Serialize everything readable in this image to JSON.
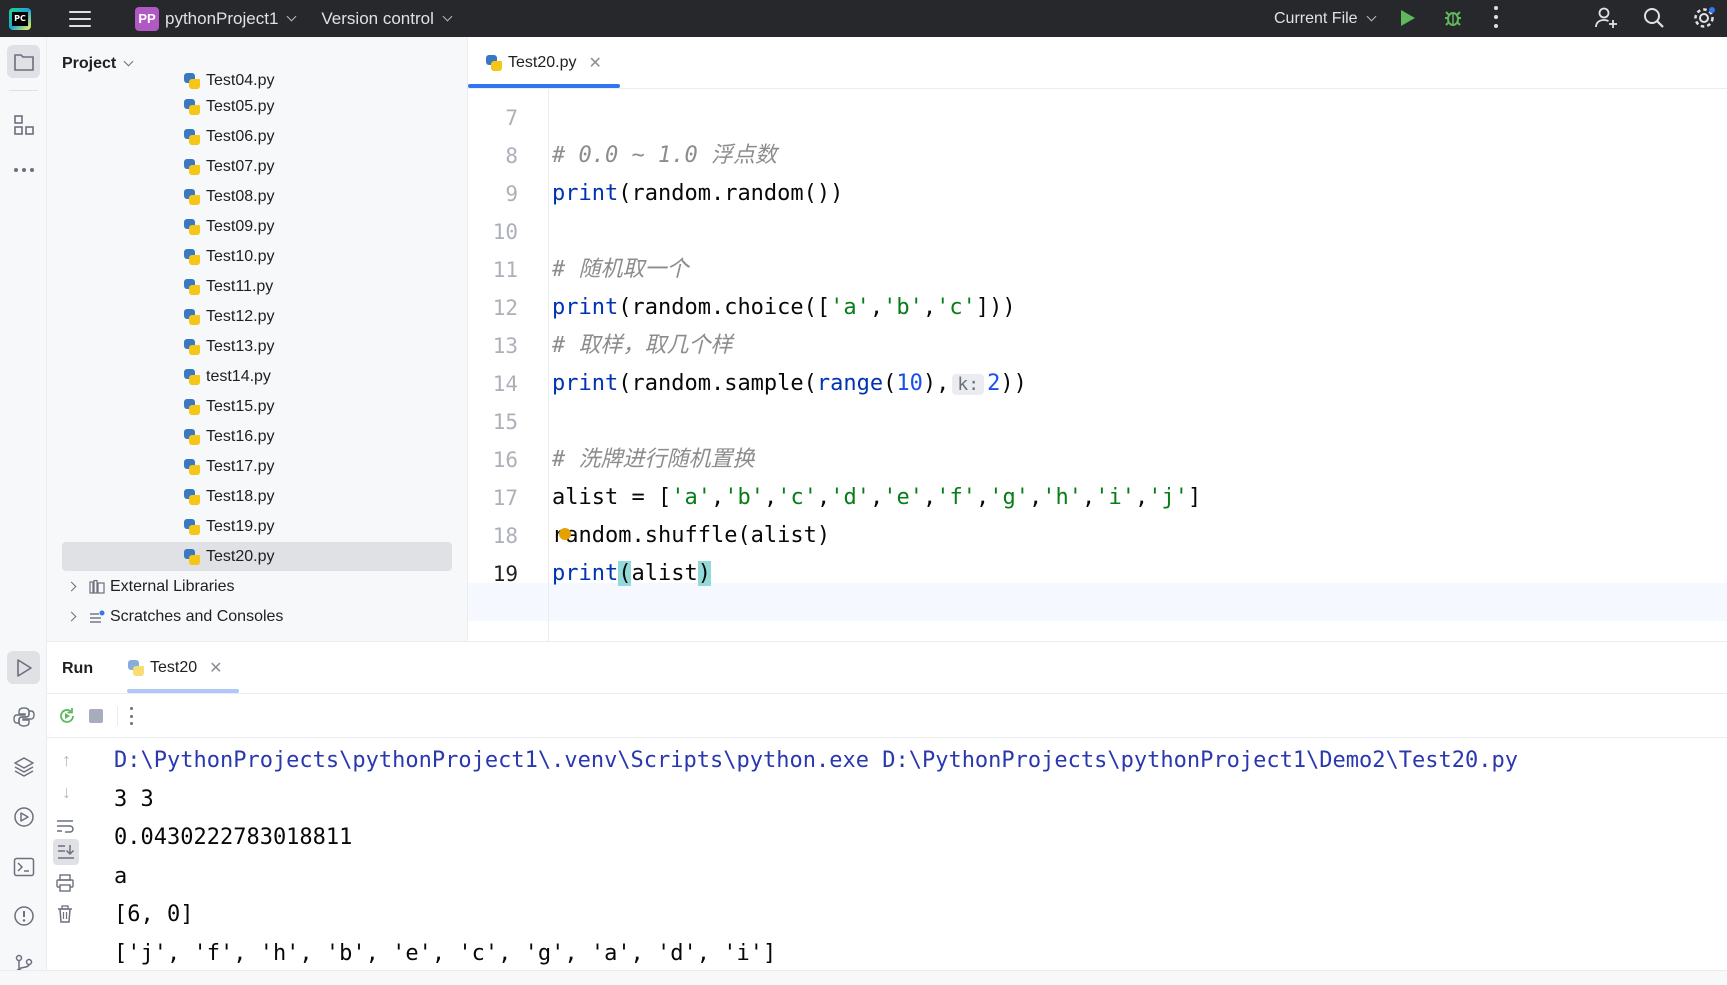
{
  "titlebar": {
    "project_badge": "PP",
    "project_name": "pythonProject1",
    "vcs_label": "Version control",
    "run_config": "Current File"
  },
  "project_panel": {
    "title": "Project",
    "files": [
      "Test04.py",
      "Test05.py",
      "Test06.py",
      "Test07.py",
      "Test08.py",
      "Test09.py",
      "Test10.py",
      "Test11.py",
      "Test12.py",
      "Test13.py",
      "test14.py",
      "Test15.py",
      "Test16.py",
      "Test17.py",
      "Test18.py",
      "Test19.py",
      "Test20.py"
    ],
    "selected_file": "Test20.py",
    "external_libraries": "External Libraries",
    "scratches": "Scratches and Consoles"
  },
  "editor": {
    "tab_label": "Test20.py",
    "line_numbers": [
      "7",
      "8",
      "9",
      "10",
      "11",
      "12",
      "13",
      "14",
      "15",
      "16",
      "17",
      "18",
      "19"
    ],
    "code": {
      "l8_comment": "# 0.0 ~ 1.0 浮点数",
      "l11_comment": "# 随机取一个",
      "l13_comment": "# 取样，取几个样",
      "l14_hint": "k:",
      "l16_comment": "# 洗牌进行随机置换"
    }
  },
  "run_panel": {
    "title": "Run",
    "tab_label": "Test20",
    "console": [
      "D:\\PythonProjects\\pythonProject1\\.venv\\Scripts\\python.exe D:\\PythonProjects\\pythonProject1\\Demo2\\Test20.py",
      "3 3",
      "0.0430222783018811",
      "a",
      "[6, 0]",
      "['j', 'f', 'h', 'b', 'e', 'c', 'g', 'a', 'd', 'i']"
    ]
  },
  "colors": {
    "accent": "#3574f0",
    "keyword": "#0033b3",
    "string": "#067d17",
    "number": "#1750eb",
    "comment": "#8c8c8c",
    "console_path": "#2a38b0"
  }
}
